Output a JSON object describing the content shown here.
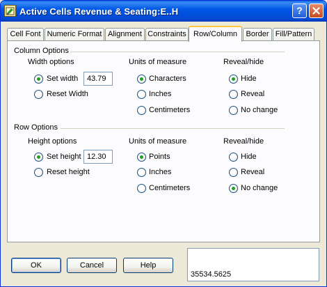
{
  "window": {
    "title": "Active Cells  Revenue & Seating:E..H",
    "help_symbol": "?"
  },
  "tabs": [
    {
      "label": "Cell Font",
      "active": false
    },
    {
      "label": "Numeric Format",
      "active": false
    },
    {
      "label": "Alignment",
      "active": false
    },
    {
      "label": "Constraints",
      "active": false
    },
    {
      "label": "Row/Column",
      "active": true
    },
    {
      "label": "Border",
      "active": false
    },
    {
      "label": "Fill/Pattern",
      "active": false
    }
  ],
  "column_options": {
    "title": "Column Options",
    "width_options": {
      "label": "Width options",
      "set_label": "Set width",
      "set_value": "43.79",
      "reset_label": "Reset Width",
      "selected": "set"
    },
    "units": {
      "label": "Units of measure",
      "options": [
        "Characters",
        "Inches",
        "Centimeters"
      ],
      "selected": "Characters"
    },
    "reveal": {
      "label": "Reveal/hide",
      "options": [
        "Hide",
        "Reveal",
        "No change"
      ],
      "selected": "Hide"
    }
  },
  "row_options": {
    "title": "Row Options",
    "height_options": {
      "label": "Height options",
      "set_label": "Set height",
      "set_value": "12.30",
      "reset_label": "Reset height",
      "selected": "set"
    },
    "units": {
      "label": "Units of measure",
      "options": [
        "Points",
        "Inches",
        "Centimeters"
      ],
      "selected": "Points"
    },
    "reveal": {
      "label": "Reveal/hide",
      "options": [
        "Hide",
        "Reveal",
        "No change"
      ],
      "selected": "No change"
    }
  },
  "buttons": {
    "ok": "OK",
    "cancel": "Cancel",
    "help": "Help"
  },
  "value_display": "35534.5625",
  "colors": {
    "title_bar": "#0058E6",
    "active_tab_accent": "#FFC83C",
    "radio_dot": "#21A121"
  }
}
